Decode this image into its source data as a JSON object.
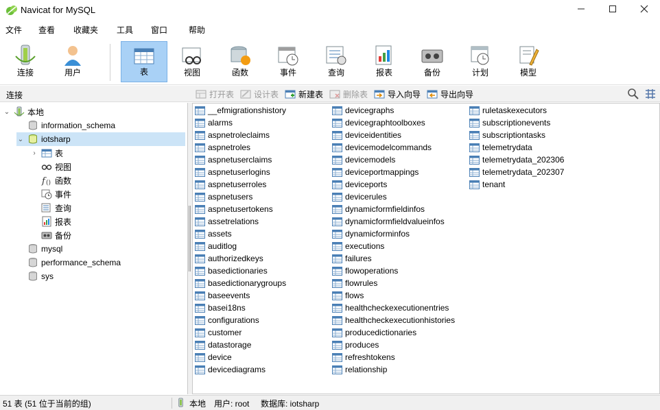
{
  "window": {
    "title": "Navicat for MySQL"
  },
  "menu": [
    "文件",
    "查看",
    "收藏夹",
    "工具",
    "窗口",
    "帮助"
  ],
  "toolbar": [
    {
      "label": "连接",
      "icon": "connection-icon"
    },
    {
      "label": "用户",
      "icon": "user-icon"
    },
    {
      "label": "表",
      "icon": "table-icon",
      "active": true
    },
    {
      "label": "视图",
      "icon": "view-icon"
    },
    {
      "label": "函数",
      "icon": "function-icon"
    },
    {
      "label": "事件",
      "icon": "event-icon"
    },
    {
      "label": "查询",
      "icon": "query-icon"
    },
    {
      "label": "报表",
      "icon": "report-icon"
    },
    {
      "label": "备份",
      "icon": "backup-icon"
    },
    {
      "label": "计划",
      "icon": "schedule-icon"
    },
    {
      "label": "模型",
      "icon": "model-icon"
    }
  ],
  "subbar": {
    "connection_label": "连接",
    "buttons": [
      {
        "label": "打开表",
        "enabled": false
      },
      {
        "label": "设计表",
        "enabled": false
      },
      {
        "label": "新建表",
        "enabled": true
      },
      {
        "label": "删除表",
        "enabled": false
      },
      {
        "label": "导入向导",
        "enabled": true
      },
      {
        "label": "导出向导",
        "enabled": true
      }
    ]
  },
  "tree": {
    "root": "本地",
    "databases": [
      "information_schema",
      "iotsharp",
      "mysql",
      "performance_schema",
      "sys"
    ],
    "open_db": "iotsharp",
    "open_db_children": [
      "表",
      "视图",
      "函数",
      "事件",
      "查询",
      "报表",
      "备份"
    ]
  },
  "tables": {
    "col1": [
      "__efmigrationshistory",
      "alarms",
      "aspnetroleclaims",
      "aspnetroles",
      "aspnetuserclaims",
      "aspnetuserlogins",
      "aspnetuserroles",
      "aspnetusers",
      "aspnetusertokens",
      "assetrelations",
      "assets",
      "auditlog",
      "authorizedkeys",
      "basedictionaries",
      "basedictionarygroups",
      "baseevents",
      "basei18ns",
      "configurations",
      "customer",
      "datastorage",
      "device",
      "devicediagrams"
    ],
    "col2": [
      "devicegraphs",
      "devicegraphtoolboxes",
      "deviceidentities",
      "devicemodelcommands",
      "devicemodels",
      "deviceportmappings",
      "deviceports",
      "devicerules",
      "dynamicformfieldinfos",
      "dynamicformfieldvalueinfos",
      "dynamicforminfos",
      "executions",
      "failures",
      "flowoperations",
      "flowrules",
      "flows",
      "healthcheckexecutionentries",
      "healthcheckexecutionhistories",
      "producedictionaries",
      "produces",
      "refreshtokens",
      "relationship"
    ],
    "col3": [
      "ruletaskexecutors",
      "subscriptionevents",
      "subscriptiontasks",
      "telemetrydata",
      "telemetrydata_202306",
      "telemetrydata_202307",
      "tenant"
    ]
  },
  "status": {
    "count": "51 表 (51 位于当前的组)",
    "location": "本地",
    "user": "用户: root",
    "database": "数据库: iotsharp"
  },
  "colors": {
    "selection": "#cce4f7",
    "toolbar_active": "#a9d1f6",
    "accent": "#2f7fd0"
  }
}
